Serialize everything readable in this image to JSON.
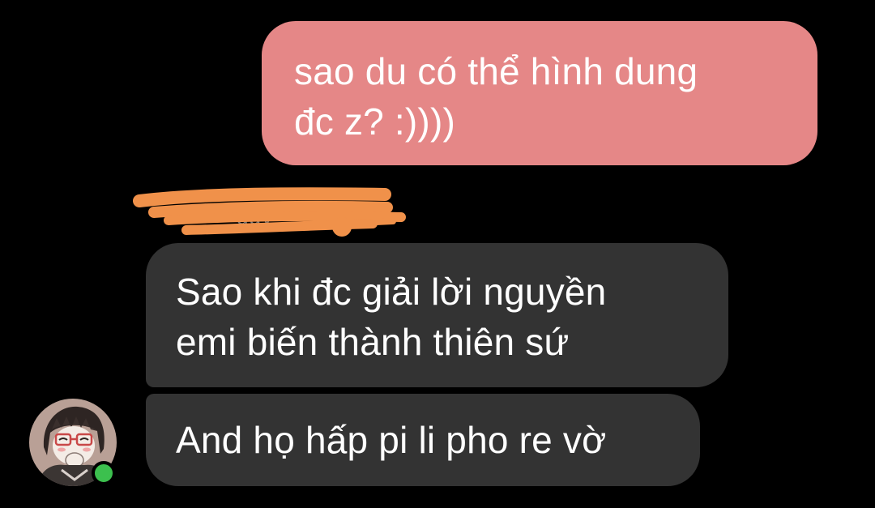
{
  "colors": {
    "background": "#000000",
    "outgoing_bubble": "#e58787",
    "incoming_bubble": "#333333",
    "message_text": "#ffffff",
    "presence_online": "#3cc04e",
    "redaction_mark": "#f0914a"
  },
  "messages": [
    {
      "direction": "outgoing",
      "text": "sao du có thể hình dung\nđc z? :))))"
    },
    {
      "direction": "incoming",
      "text": "Sao khi đc giải lời nguyền\nemi biến thành thiên sứ"
    },
    {
      "direction": "incoming",
      "text": "And họ hấp pi li pho re vờ"
    }
  ],
  "sender": {
    "name_visible_fragment": "ggy",
    "avatar_icon": "avatar-icon",
    "presence_status": "online"
  }
}
